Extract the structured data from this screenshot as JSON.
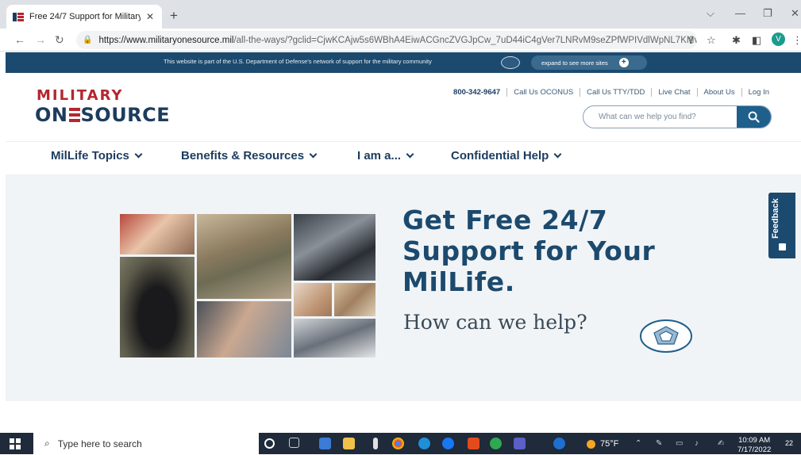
{
  "browser": {
    "tab_title": "Free 24/7 Support for Military Li",
    "url_host": "https://www.militaryonesource.mil",
    "url_rest": "/all-the-ways/?gclid=CjwKCAjw5s6WBhA4EiwACGncZVGJpCw_7uD44iC4gVer7LNRvM9seZPfWPIVdlWpNL7KMv0bZ...",
    "profile_initial": "V"
  },
  "dod_banner": {
    "text": "This website is part of the U.S. Department of Defense's network of support for the military community",
    "expand_label": "expand to see more sites"
  },
  "header": {
    "logo_line1": "MILITARY",
    "logo_line2_a": "ON",
    "logo_line2_b": "SOURCE",
    "utility": {
      "phone": "800-342-9647",
      "links": [
        "Call Us OCONUS",
        "Call Us TTY/TDD",
        "Live Chat",
        "About Us",
        "Log In"
      ]
    },
    "search_placeholder": "What can we help you find?"
  },
  "nav": {
    "items": [
      "MilLife Topics",
      "Benefits & Resources",
      "I am a...",
      "Confidential Help"
    ]
  },
  "hero": {
    "title": "Get Free 24/7 Support for Your MilLife.",
    "subtitle": "How can we help?"
  },
  "feedback_label": "Feedback",
  "taskbar": {
    "search_placeholder": "Type here to search",
    "temperature": "75°F",
    "time": "10:09 AM",
    "date": "7/17/2022",
    "notification_count": "22"
  },
  "colors": {
    "navy": "#1c4a6e",
    "brand_red": "#b5262e",
    "search_blue": "#1f5f8b"
  }
}
